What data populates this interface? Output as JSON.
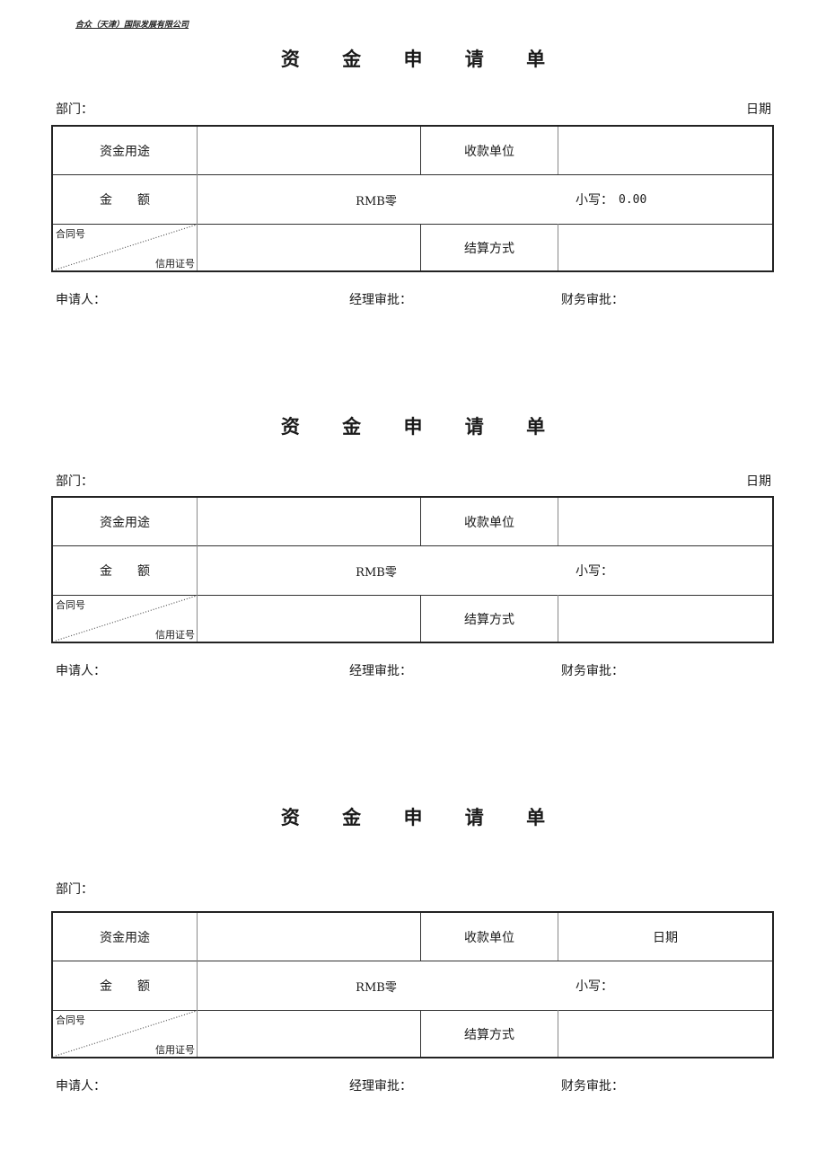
{
  "company_name": "合众（天津）国际发展有限公司",
  "forms": [
    {
      "title": "资 金 申 请 单",
      "department_label": "部门：",
      "date_label": "日期",
      "rows": {
        "purpose_label": "资金用途",
        "purpose_value": "",
        "payee_label": "收款单位",
        "payee_value": "",
        "amount_label": "金　　额",
        "amount_words": "RMB零",
        "amount_figures_label": "小写：",
        "amount_figures_value": "0.00",
        "contract_label": "合同号",
        "lc_label": "信用证号",
        "contract_value": "",
        "settlement_label": "结算方式",
        "settlement_value": ""
      },
      "signatures": {
        "applicant": "申请人：",
        "manager": "经理审批：",
        "finance": "财务审批："
      }
    },
    {
      "title": "资 金 申 请 单",
      "department_label": "部门：",
      "date_label": "日期",
      "rows": {
        "purpose_label": "资金用途",
        "purpose_value": "",
        "payee_label": "收款单位",
        "payee_value": "",
        "amount_label": "金　　额",
        "amount_words": "RMB零",
        "amount_figures_label": "小写：",
        "amount_figures_value": "",
        "contract_label": "合同号",
        "lc_label": "信用证号",
        "contract_value": "",
        "settlement_label": "结算方式",
        "settlement_value": ""
      },
      "signatures": {
        "applicant": "申请人：",
        "manager": "经理审批：",
        "finance": "财务审批："
      }
    },
    {
      "title": "资 金 申 请 单",
      "department_label": "部门：",
      "date_label": "",
      "rows": {
        "purpose_label": "资金用途",
        "purpose_value": "",
        "payee_label": "收款单位",
        "payee_value": "日期",
        "amount_label": "金　　额",
        "amount_words": "RMB零",
        "amount_figures_label": "小写：",
        "amount_figures_value": "",
        "contract_label": "合同号",
        "lc_label": "信用证号",
        "contract_value": "",
        "settlement_label": "结算方式",
        "settlement_value": ""
      },
      "signatures": {
        "applicant": "申请人：",
        "manager": "经理审批：",
        "finance": "财务审批："
      }
    }
  ]
}
